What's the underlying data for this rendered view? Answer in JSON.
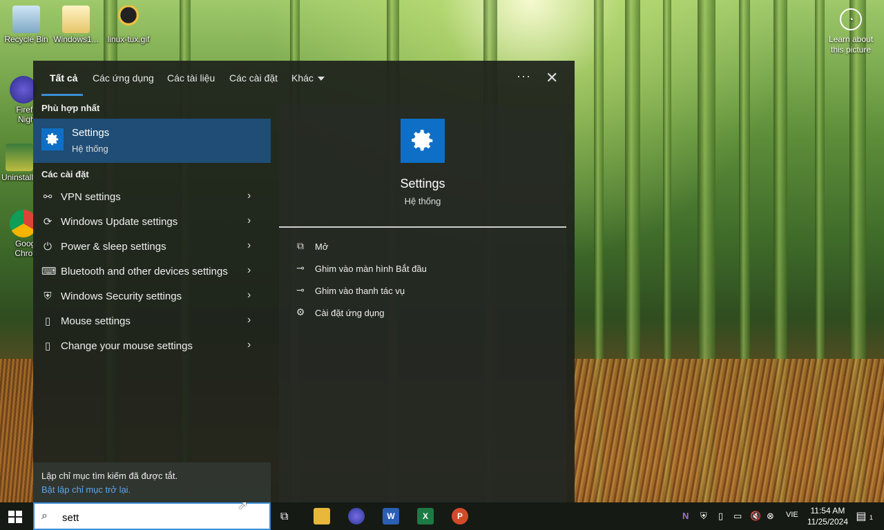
{
  "desktop": {
    "icons": [
      {
        "label": "Recycle Bin",
        "icon": "recycle-bin-icon"
      },
      {
        "label": "Windows1...",
        "icon": "folder-icon"
      },
      {
        "label": "linux-tux.gif",
        "icon": "tux-image-icon"
      },
      {
        "label": "Firefo Night",
        "icon": "firefox-nightly-icon"
      },
      {
        "label": "Uninstall",
        "icon": "uninstall-icon"
      },
      {
        "label": "Googl Chron",
        "icon": "chrome-icon"
      }
    ],
    "learn_about": "Learn about this picture"
  },
  "search_panel": {
    "tabs": [
      {
        "label": "Tất cả",
        "active": true
      },
      {
        "label": "Các ứng dụng"
      },
      {
        "label": "Các tài liệu"
      },
      {
        "label": "Các cài đặt"
      },
      {
        "label": "Khác"
      }
    ],
    "more_label": "···",
    "close_label": "✕",
    "best_match_heading": "Phù hợp nhất",
    "best_match": {
      "title": "Settings",
      "subtitle": "Hệ thống"
    },
    "settings_heading": "Các cài đặt",
    "settings_items": [
      {
        "label": "VPN settings",
        "icon": "vpn-icon"
      },
      {
        "label": "Windows Update settings",
        "icon": "refresh-icon"
      },
      {
        "label": "Power & sleep settings",
        "icon": "power-icon"
      },
      {
        "label": "Bluetooth and other devices settings",
        "icon": "keyboard-icon"
      },
      {
        "label": "Windows Security settings",
        "icon": "shield-icon"
      },
      {
        "label": "Mouse settings",
        "icon": "mouse-icon"
      },
      {
        "label": "Change your mouse settings",
        "icon": "mouse-icon"
      }
    ],
    "footer": {
      "line1": "Lập chỉ mục tìm kiếm đã được tắt.",
      "link": "Bật lập chỉ mục trở lại."
    },
    "detail": {
      "title": "Settings",
      "subtitle": "Hệ thống",
      "actions": [
        {
          "label": "Mở",
          "icon": "open-icon"
        },
        {
          "label": "Ghim vào màn hình Bắt đầu",
          "icon": "pin-icon"
        },
        {
          "label": "Ghim vào thanh tác vụ",
          "icon": "pin-icon"
        },
        {
          "label": "Cài đặt ứng dụng",
          "icon": "gear-icon"
        }
      ]
    }
  },
  "taskbar": {
    "search_value": "sett",
    "language": "VIE",
    "time": "11:54 AM",
    "date": "11/25/2024",
    "notification_count": "1",
    "colors": {
      "accent": "#3b8fd6",
      "tile": "#0f6fc6",
      "selected": "#1f4d75"
    }
  }
}
